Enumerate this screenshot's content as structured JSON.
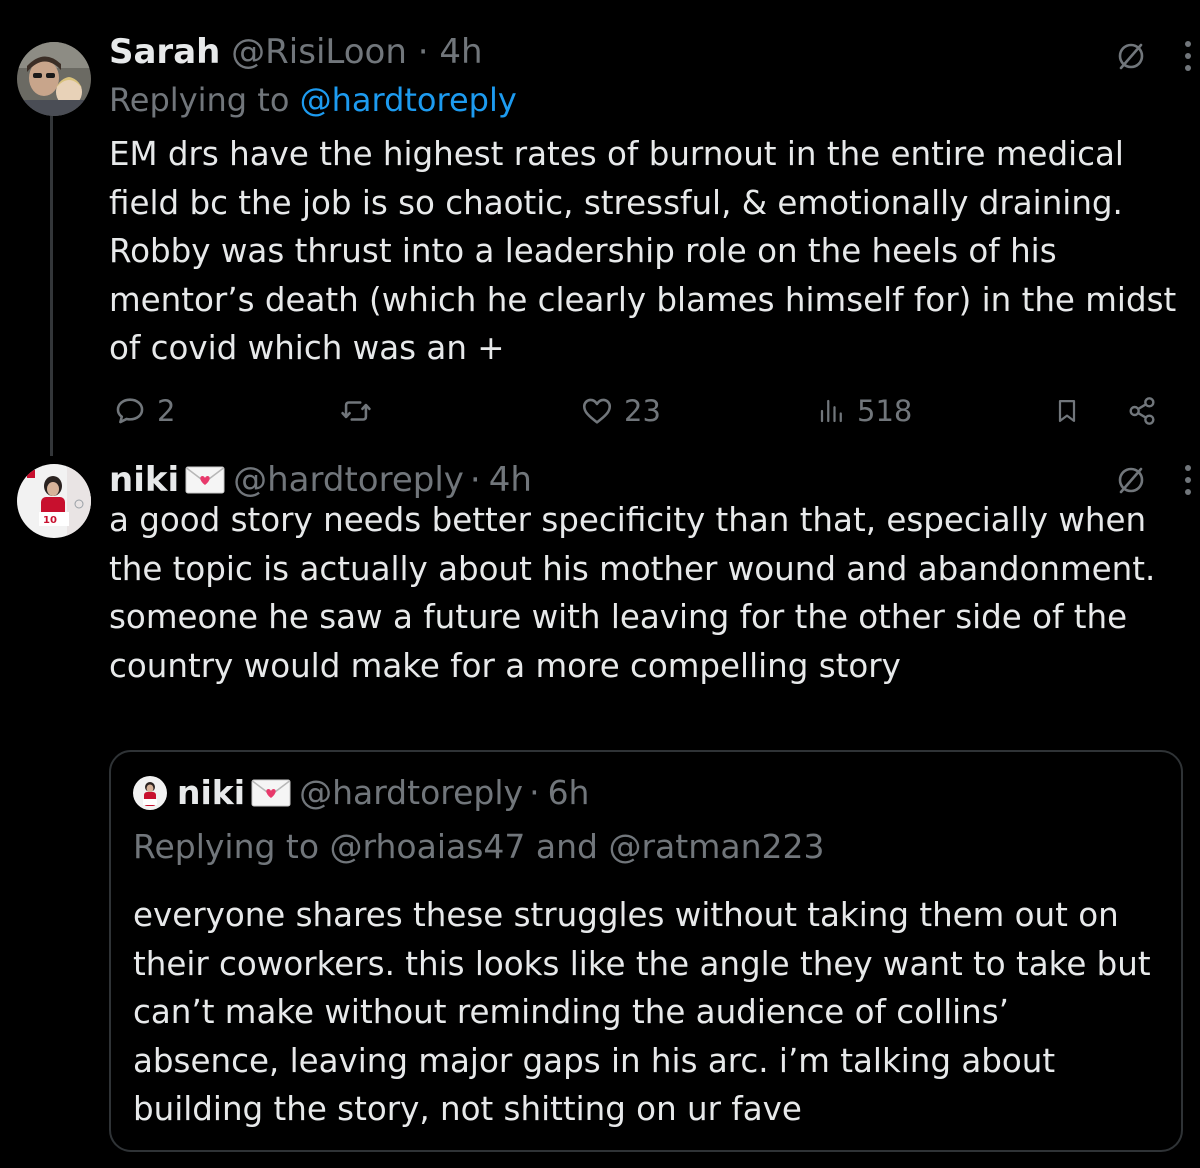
{
  "thread": {
    "parent": {
      "display_name": "Sarah",
      "handle": "@RisiLoon",
      "separator": "·",
      "time": "4h",
      "replying_prefix": "Replying to",
      "replying_to": "@hardtoreply",
      "text": "EM drs have the highest rates of burnout in the entire medical field bc the job is so chaotic, stressful, & emotionally draining. Robby was thrust into a leadership role on the heels of his mentor’s death (which he clearly blames himself for) in the midst of covid which was an +",
      "actions": {
        "replies": "2",
        "reposts": "",
        "likes": "23",
        "views": "518"
      }
    },
    "reply": {
      "display_name": "niki",
      "name_emoji": "love-letter-envelope",
      "handle": "@hardtoreply",
      "separator": "·",
      "time": "4h",
      "text": "a good story needs better specificity than that, especially when the topic is actually about his mother wound and abandonment. someone he saw a future with leaving for the other side of the country would make for a more compelling story"
    },
    "quoted": {
      "display_name": "niki",
      "name_emoji": "love-letter-envelope",
      "handle": "@hardtoreply",
      "separator": "·",
      "time": "6h",
      "replying_line": "Replying to @rhoaias47 and @ratman223",
      "text": "everyone shares these struggles without taking them out on their coworkers. this looks like the angle they want to take but can’t make without reminding the audience of collins’ absence, leaving major gaps in his arc. i’m talking about building the story, not shitting on ur fave"
    }
  },
  "icons": {
    "grok": "grok-slash-circle-icon",
    "more": "more-vertical-icon",
    "reply": "reply-bubble-icon",
    "repost": "repost-icon",
    "like": "heart-icon",
    "views": "views-bar-icon",
    "bookmark": "bookmark-icon",
    "share": "share-icon"
  },
  "colors": {
    "background": "#000000",
    "text": "#e7e9ea",
    "muted": "#71767b",
    "link": "#1d9bf0",
    "border": "#2f3336"
  }
}
